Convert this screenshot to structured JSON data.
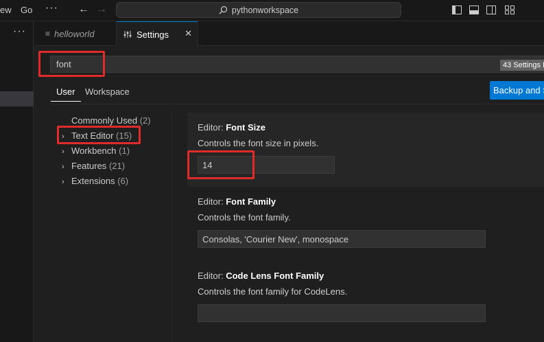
{
  "menubar": {
    "view_partial": "ew",
    "go": "Go",
    "more": "···"
  },
  "command_center": {
    "text": "pythonworkspace"
  },
  "sidebar": {
    "more": "···"
  },
  "tabs": [
    {
      "label": "helloworld",
      "icon": "file-icon",
      "active": false
    },
    {
      "label": "Settings",
      "icon": "settings-sliders-icon",
      "active": true
    }
  ],
  "search": {
    "value": "font",
    "results": "43 Settings F"
  },
  "scope_tabs": {
    "user": "User",
    "workspace": "Workspace"
  },
  "backup_button": "Backup and S",
  "toc": [
    {
      "label": "Commonly Used",
      "count": "(2)",
      "chevron": ""
    },
    {
      "label": "Text Editor",
      "count": "(15)",
      "chevron": "›"
    },
    {
      "label": "Workbench",
      "count": "(1)",
      "chevron": "›"
    },
    {
      "label": "Features",
      "count": "(21)",
      "chevron": "›"
    },
    {
      "label": "Extensions",
      "count": "(6)",
      "chevron": "›"
    }
  ],
  "settings": [
    {
      "category": "Editor:",
      "name": "Font Size",
      "description": "Controls the font size in pixels.",
      "value": "14"
    },
    {
      "category": "Editor:",
      "name": "Font Family",
      "description": "Controls the font family.",
      "value": "Consolas, 'Courier New', monospace"
    },
    {
      "category": "Editor:",
      "name": "Code Lens Font Family",
      "description": "Controls the font family for CodeLens.",
      "value": ""
    }
  ],
  "colors": {
    "accent": "#0078d4",
    "annotation": "#e02b2b",
    "background": "#1f1f1f"
  }
}
